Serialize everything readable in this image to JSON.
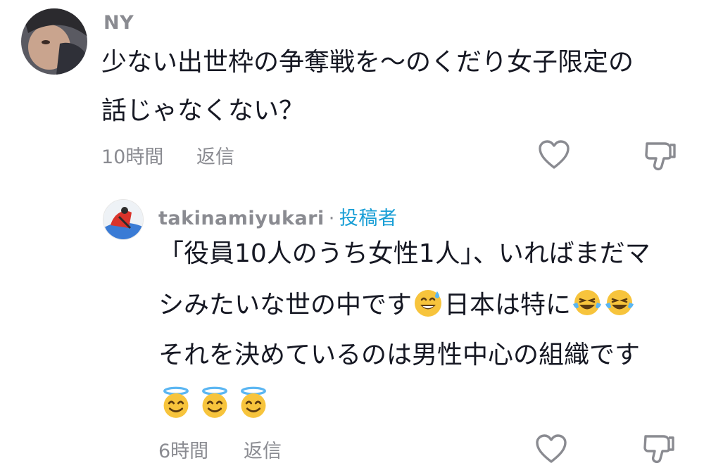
{
  "comments": [
    {
      "username": "NY",
      "lines": [
        "少ない出世枠の争奪戦を〜のくだり女子限定の",
        "話じゃなくない？"
      ],
      "time": "10時間",
      "reply_label": "返信"
    }
  ],
  "reply": {
    "username": "takinamiyukari",
    "separator": "·",
    "author_badge": "投稿者",
    "line1": "「役員10人のうち女性1人」、いればまだマ",
    "line2": "シみたいな世の中です",
    "line2b": "日本は特に",
    "line3": "それを決めているのは男性中心の組織です",
    "emojis": [
      "sweat-smile-emoji",
      "joy-emoji",
      "halo-emoji"
    ],
    "time": "6時間",
    "reply_label": "返信"
  },
  "icons": [
    "heart-icon",
    "dislike-icon"
  ],
  "colors": {
    "muted": "#8a8b91",
    "accent": "#1a9fd6",
    "text": "#161823"
  }
}
